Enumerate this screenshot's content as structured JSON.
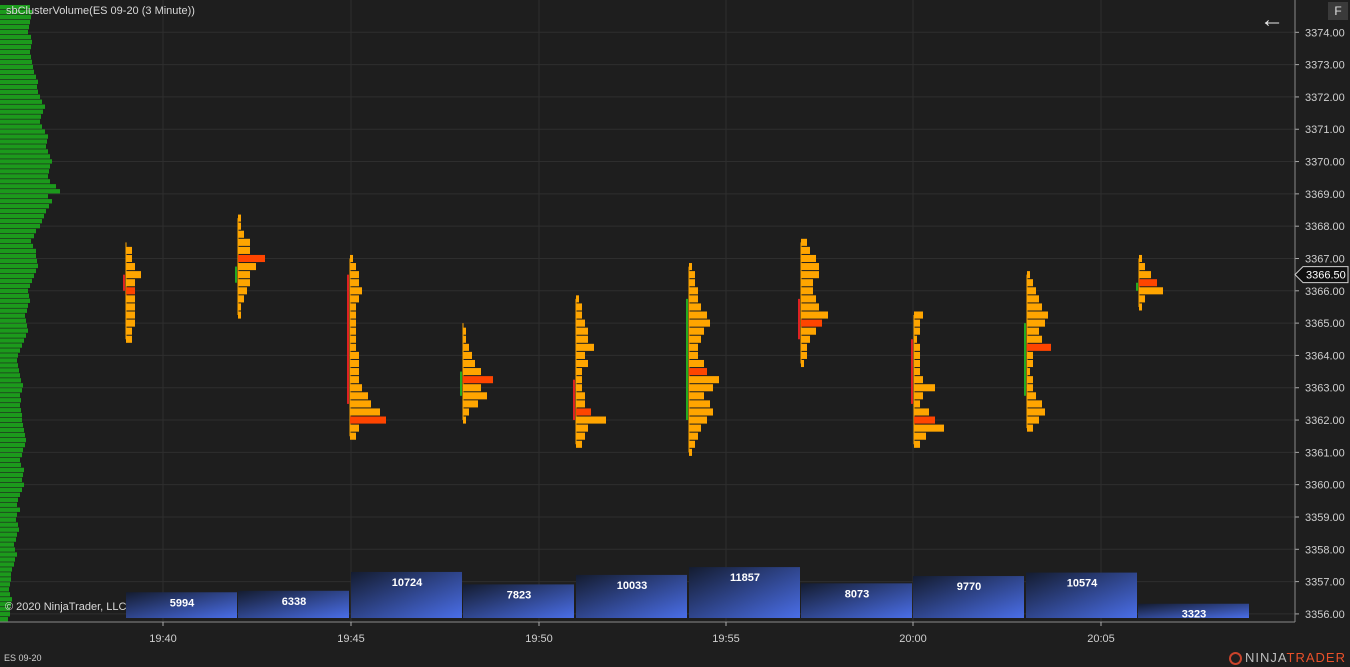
{
  "title": "sbClusterVolume(ES 09-20 (3 Minute))",
  "copyright": "© 2020 NinjaTrader, LLC",
  "instrument": "ES 09-20",
  "brand": {
    "part1": "NINJA",
    "part2": "TRADER"
  },
  "f_button": "F",
  "back_icon": "arrow-left-icon",
  "price_marker": "3366.50",
  "colors": {
    "background": "#1e1e1e",
    "grid": "#2e2e2e",
    "cluster": "#ffa500",
    "poc": "#ff4500",
    "volume_top": "#4a6ee8",
    "volume_bottom": "#141c30",
    "profile": "#1c9a1c",
    "candle_up": "#22aa22",
    "candle_down": "#dd2222"
  },
  "chart_data": {
    "type": "bar",
    "y_range": [
      3355.75,
      3375
    ],
    "y_ticks": [
      "3374.00",
      "3373.00",
      "3372.00",
      "3371.00",
      "3370.00",
      "3369.00",
      "3368.00",
      "3367.00",
      "3366.00",
      "3365.00",
      "3364.00",
      "3363.00",
      "3362.00",
      "3361.00",
      "3360.00",
      "3359.00",
      "3358.00",
      "3357.00",
      "3356.00"
    ],
    "x_ticks": [
      "19:40",
      "19:45",
      "19:50",
      "19:55",
      "20:00",
      "20:05"
    ],
    "volume": {
      "max": 17000,
      "values": [
        5994,
        6338,
        10724,
        7823,
        10033,
        11857,
        8073,
        9770,
        10574,
        3323
      ]
    },
    "bars": [
      {
        "low": 3364.5,
        "high": 3367.5,
        "open": 3366.5,
        "close": 3366.0,
        "poc": 3366.0,
        "vol": [
          2,
          2,
          3,
          3,
          3,
          3,
          3,
          3,
          5,
          3,
          2,
          2
        ]
      },
      {
        "low": 3365.25,
        "high": 3368.25,
        "open": 3366.25,
        "close": 3366.75,
        "poc": 3367.0,
        "vol": [
          1,
          1,
          2,
          3,
          4,
          4,
          6,
          9,
          4,
          4,
          2,
          1,
          1
        ]
      },
      {
        "low": 3361.5,
        "high": 3367.0,
        "open": 3366.5,
        "close": 3362.5,
        "poc": 3362.0,
        "vol": [
          2,
          3,
          12,
          10,
          7,
          6,
          4,
          3,
          3,
          3,
          3,
          2,
          2,
          2,
          2,
          2,
          2,
          3,
          4,
          3,
          3,
          2,
          1
        ]
      },
      {
        "low": 3362.0,
        "high": 3365.0,
        "open": 3362.75,
        "close": 3363.5,
        "poc": 3363.25,
        "vol": [
          1,
          2,
          5,
          8,
          6,
          10,
          6,
          4,
          3,
          2,
          1,
          1
        ]
      },
      {
        "low": 3361.25,
        "high": 3365.75,
        "open": 3363.25,
        "close": 3362.0,
        "poc": 3362.25,
        "vol": [
          2,
          3,
          4,
          10,
          5,
          3,
          3,
          2,
          2,
          2,
          4,
          3,
          6,
          4,
          4,
          3,
          2,
          2,
          1
        ]
      },
      {
        "low": 3361.0,
        "high": 3366.75,
        "open": 3362.0,
        "close": 3365.75,
        "poc": 3363.5,
        "vol": [
          1,
          2,
          3,
          4,
          6,
          8,
          7,
          5,
          8,
          10,
          6,
          5,
          3,
          3,
          4,
          5,
          7,
          6,
          4,
          3,
          3,
          2,
          2,
          1
        ]
      },
      {
        "low": 3363.75,
        "high": 3367.5,
        "open": 3365.75,
        "close": 3364.5,
        "poc": 3365.0,
        "vol": [
          1,
          2,
          2,
          3,
          5,
          7,
          9,
          6,
          5,
          4,
          4,
          6,
          6,
          5,
          3,
          2
        ]
      },
      {
        "low": 3361.25,
        "high": 3365.25,
        "open": 3364.5,
        "close": 3362.5,
        "poc": 3362.0,
        "vol": [
          2,
          4,
          10,
          7,
          5,
          2,
          3,
          7,
          3,
          2,
          2,
          2,
          2,
          1,
          2,
          2,
          3
        ]
      },
      {
        "low": 3361.75,
        "high": 3366.5,
        "open": 3362.75,
        "close": 3365.0,
        "poc": 3364.25,
        "vol": [
          2,
          4,
          6,
          5,
          3,
          2,
          2,
          1,
          2,
          2,
          8,
          5,
          4,
          6,
          7,
          5,
          4,
          3,
          2,
          1
        ]
      },
      {
        "low": 3365.5,
        "high": 3367.0,
        "open": 3366.0,
        "close": 3366.25,
        "poc": 3366.25,
        "vol": [
          1,
          2,
          8,
          6,
          4,
          2,
          1
        ]
      }
    ],
    "profile": [
      8,
      10,
      10,
      11,
      12,
      10,
      9,
      10,
      11,
      11,
      12,
      14,
      15,
      17,
      15,
      14,
      16,
      17,
      19,
      18,
      16,
      17,
      20,
      17,
      18,
      20,
      22,
      24,
      22,
      23,
      24,
      21,
      20,
      22,
      23,
      25,
      26,
      25,
      24,
      23,
      22,
      22,
      21,
      20,
      21,
      20,
      22,
      23,
      21,
      20,
      19,
      18,
      17,
      18,
      20,
      22,
      24,
      26,
      28,
      27,
      26,
      25,
      27,
      28,
      30,
      29,
      28,
      30,
      32,
      34,
      36,
      38,
      37,
      36,
      36,
      33,
      31,
      34,
      36,
      40,
      42,
      44,
      46,
      49,
      52,
      48,
      60,
      56,
      50,
      48,
      49,
      50,
      52,
      50,
      48,
      46,
      47,
      48,
      45,
      42,
      40,
      41,
      43,
      45,
      42,
      40,
      38,
      37,
      38,
      36,
      34,
      33,
      32,
      31,
      30,
      31,
      32,
      31,
      28,
      29,
      30,
      31,
      32,
      30
    ]
  }
}
